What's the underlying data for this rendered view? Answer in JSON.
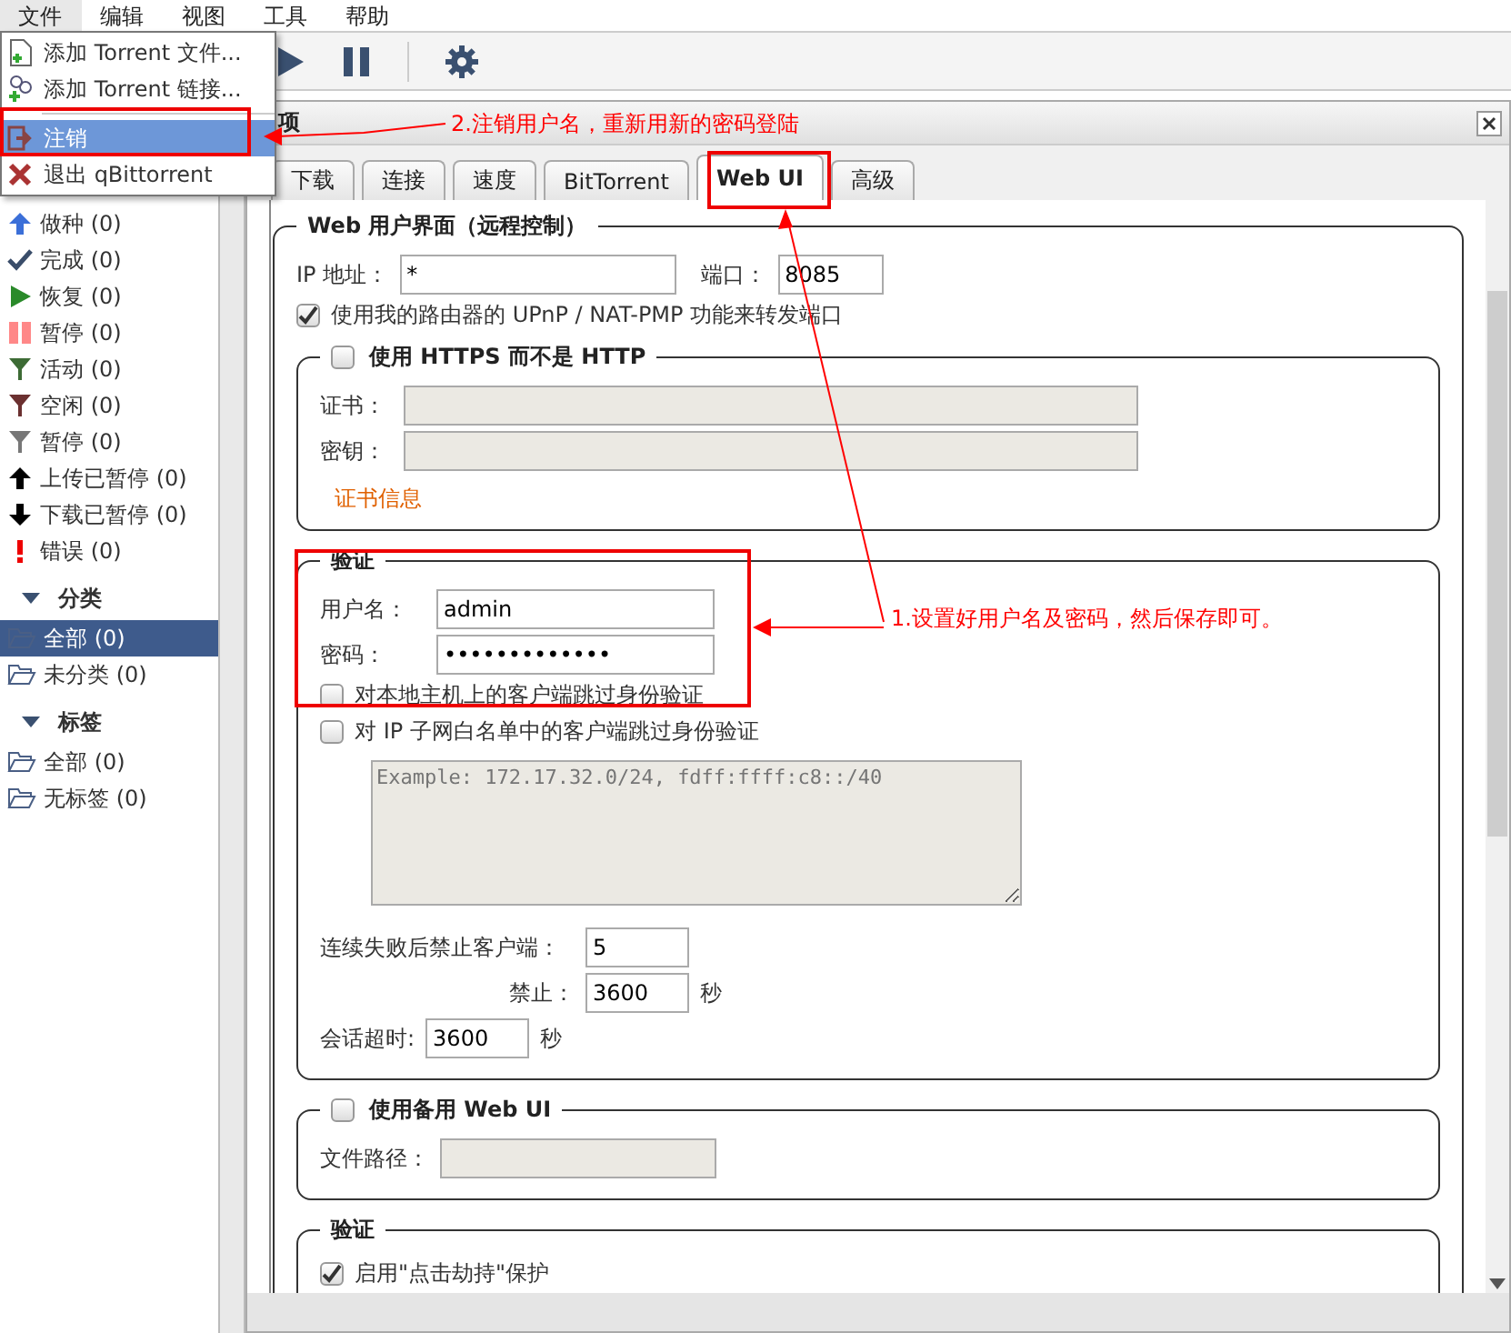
{
  "menubar": [
    {
      "label": "文件",
      "selected": true
    },
    {
      "label": "编辑",
      "selected": false
    },
    {
      "label": "视图",
      "selected": false
    },
    {
      "label": "工具",
      "selected": false
    },
    {
      "label": "帮助",
      "selected": false
    }
  ],
  "file_menu": [
    {
      "label": "添加 Torrent 文件...",
      "selected": false
    },
    {
      "label": "添加 Torrent 链接...",
      "selected": false
    },
    {
      "label": "注销",
      "selected": true
    },
    {
      "label": "退出 qBittorrent",
      "selected": false
    }
  ],
  "sidebar": {
    "status": [
      {
        "label": "做种 (0)"
      },
      {
        "label": "完成 (0)"
      },
      {
        "label": "恢复 (0)"
      },
      {
        "label": "暂停 (0)"
      },
      {
        "label": "活动 (0)"
      },
      {
        "label": "空闲 (0)"
      },
      {
        "label": "暂停 (0)"
      },
      {
        "label": "上传已暂停 (0)"
      },
      {
        "label": "下载已暂停 (0)"
      },
      {
        "label": "错误 (0)"
      }
    ],
    "sections": [
      {
        "title": "分类",
        "expanded": true,
        "items": [
          {
            "label": "全部 (0)",
            "selected": true
          },
          {
            "label": "未分类 (0)",
            "selected": false
          }
        ]
      },
      {
        "title": "标签",
        "expanded": true,
        "items": [
          {
            "label": "全部 (0)",
            "selected": false
          },
          {
            "label": "无标签 (0)",
            "selected": false
          }
        ]
      }
    ]
  },
  "dialog": {
    "title": "项",
    "tabs": [
      {
        "label": "下载",
        "selected": false
      },
      {
        "label": "连接",
        "selected": false
      },
      {
        "label": "速度",
        "selected": false
      },
      {
        "label": "BitTorrent",
        "selected": false
      },
      {
        "label": "Web UI",
        "selected": true
      },
      {
        "label": "高级",
        "selected": false
      }
    ],
    "webui": {
      "title": "Web 用户界面（远程控制）",
      "ip_label": "IP 地址：",
      "ip_value": "*",
      "port_label": "端口：",
      "port_value": "8085",
      "upnp": {
        "label": "使用我的路由器的 UPnP / NAT-PMP 功能来转发端口",
        "checked": true
      }
    },
    "https": {
      "label": "使用 HTTPS 而不是 HTTP",
      "checked": false,
      "cert_label": "证书：",
      "key_label": "密钥：",
      "info_link": "证书信息"
    },
    "auth": {
      "title": "验证",
      "username_label": "用户名：",
      "username": "admin",
      "password_label": "密码：",
      "password": "•••••••••••••",
      "bypass_local": {
        "label": "对本地主机上的客户端跳过身份验证",
        "checked": false
      },
      "bypass_subnet": {
        "label": "对 IP 子网白名单中的客户端跳过身份验证",
        "checked": false
      },
      "subnet_placeholder": "Example: 172.17.32.0/24, fdff:ffff:c8::/40",
      "ban_label": "连续失败后禁止客户端：",
      "ban_value": "5",
      "ban_time_label": "禁止：",
      "ban_time_value": "3600",
      "ban_time_unit": "秒",
      "session_label": "会话超时:",
      "session_value": "3600",
      "session_unit": "秒"
    },
    "alt_webui": {
      "label": "使用备用 Web UI",
      "checked": false,
      "path_label": "文件路径："
    },
    "security": {
      "title": "验证",
      "clickjacking": {
        "label": "启用\"点击劫持\"保护",
        "checked": true
      }
    }
  },
  "annotations": [
    {
      "text": "2.注销用户名，重新用新的密码登陆"
    },
    {
      "text": "1.设置好用户名及密码，然后保存即可。"
    }
  ]
}
